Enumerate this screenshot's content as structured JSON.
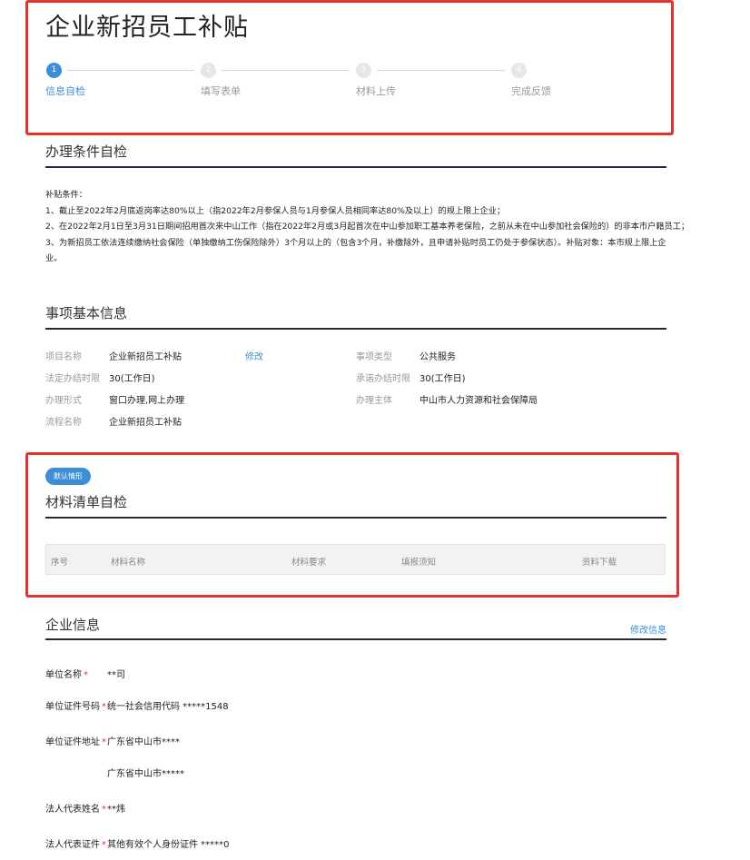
{
  "header": {
    "title": "企业新招员工补贴",
    "steps": [
      {
        "num": "1",
        "label": "信息自检"
      },
      {
        "num": "2",
        "label": "填写表单"
      },
      {
        "num": "3",
        "label": "材料上传"
      },
      {
        "num": "4",
        "label": "完成反馈"
      }
    ]
  },
  "conditions": {
    "title": "办理条件自检",
    "lines": [
      "补贴条件：",
      "1、截止至2022年2月底返岗率达80%以上（指2022年2月参保人员与1月参保人员相同率达80%及以上）的规上限上企业；",
      "2、在2022年2月1日至3月31日期间招用首次来中山工作（指在2022年2月或3月起首次在中山参加职工基本养老保险，之前从未在中山参加社会保险的）的非本市户籍员工；",
      "3、为新招员工依法连续缴纳社会保险（单独缴纳工伤保险除外）3个月以上的（包含3个月，补缴除外，且申请补贴时员工仍处于参保状态）。补贴对象：本市规上限上企",
      "业。"
    ]
  },
  "basic_info": {
    "title": "事项基本信息",
    "edit_link": "修改",
    "project_name_label": "项目名称",
    "project_name_value": "企业新招员工补贴",
    "type_label": "事项类型",
    "type_value": "公共服务",
    "legal_limit_label": "法定办结时限",
    "legal_limit_value": "30(工作日)",
    "promise_limit_label": "承诺办结时限",
    "promise_limit_value": "30(工作日)",
    "form_label": "办理形式",
    "form_value": "窗口办理,网上办理",
    "subject_label": "办理主体",
    "subject_value": "中山市人力资源和社会保障局",
    "process_label": "流程名称",
    "process_value": "企业新招员工补贴"
  },
  "materials": {
    "badge": "默认情形",
    "title": "材料清单自检",
    "columns": [
      "序号",
      "材料名称",
      "材料要求",
      "填报须知",
      "资料下载"
    ]
  },
  "company": {
    "title": "企业信息",
    "edit_link": "修改信息",
    "fields": [
      {
        "label": "单位名称",
        "value": "**司"
      },
      {
        "label": "单位证件号码",
        "value": "统一社会信用代码 *****1548"
      },
      {
        "label": "单位证件地址",
        "value": "广东省中山市****"
      },
      {
        "label": "",
        "value": "广东省中山市*****"
      },
      {
        "label": "法人代表姓名",
        "value": "**炜"
      },
      {
        "label": "法人代表证件",
        "value": "其他有效个人身份证件 *****0"
      }
    ],
    "required_mark": "*"
  },
  "colors": {
    "accent": "#3c8fd6",
    "highlight_box": "#e8312f",
    "rule": "#1e2a3e"
  }
}
